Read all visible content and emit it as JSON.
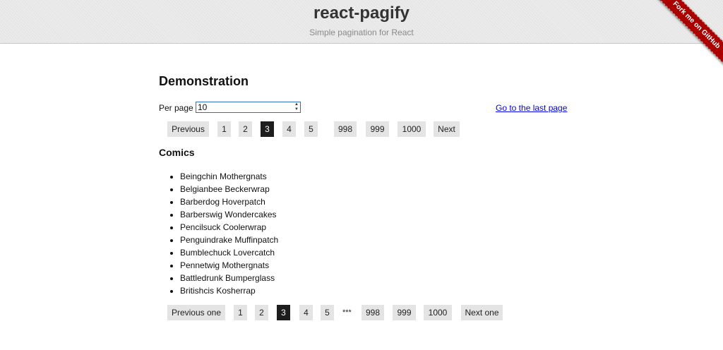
{
  "header": {
    "title": "react-pagify",
    "subtitle": "Simple pagination for React",
    "ribbon": "Fork me on GitHub"
  },
  "demo": {
    "heading": "Demonstration",
    "per_page_label": "Per page",
    "per_page_value": "10",
    "last_page_link": "Go to the last page"
  },
  "top_pager": {
    "previous": "Previous",
    "pages": [
      "1",
      "2",
      "3",
      "4",
      "5",
      "998",
      "999",
      "1000"
    ],
    "current_page": "3",
    "next": "Next"
  },
  "comics": {
    "heading": "Comics",
    "items": [
      "Beingchin Mothergnats",
      "Belgianbee Beckerwrap",
      "Barberdog Hoverpatch",
      "Barberswig Wondercakes",
      "Pencilsuck Coolerwrap",
      "Penguindrake Muffinpatch",
      "Bumblechuck Lovercatch",
      "Pennetwig Mothergnats",
      "Battledrunk Bumperglass",
      "Britishcis Kosherrap"
    ]
  },
  "bottom_pager": {
    "previous": "Previous one",
    "pages": [
      "1",
      "2",
      "3",
      "4",
      "5",
      "998",
      "999",
      "1000"
    ],
    "ellipsis": "***",
    "current_page": "3",
    "next": "Next one"
  }
}
